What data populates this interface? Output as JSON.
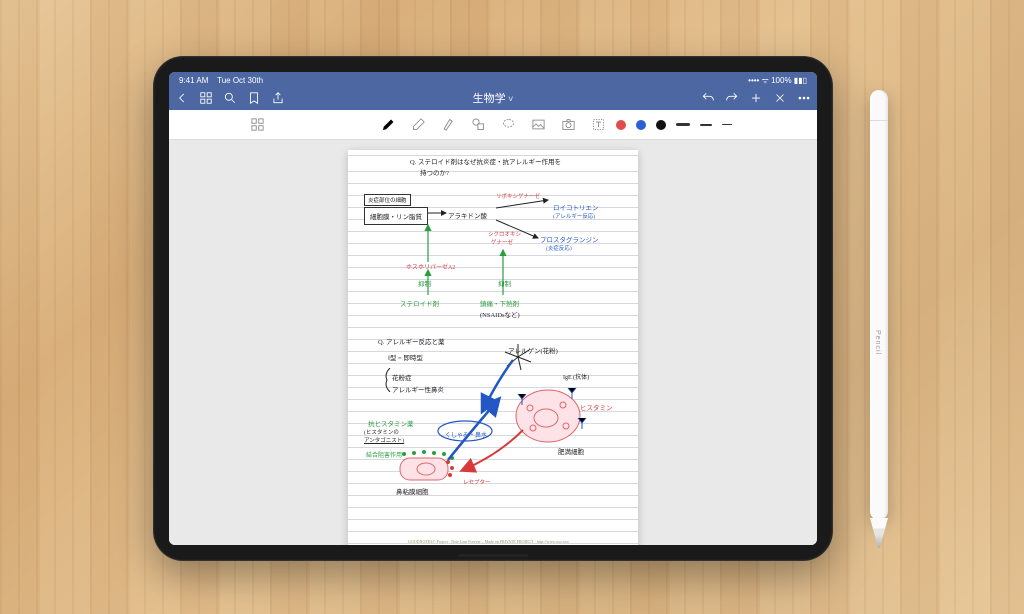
{
  "statusbar": {
    "time": "9:41 AM",
    "date": "Tue Oct 30th",
    "wifi": "100%"
  },
  "app": {
    "title": "生物学"
  },
  "nav": {
    "back": "‹",
    "grid": "grid",
    "search": "search",
    "bookmark": "bookmark",
    "share": "share",
    "undo": "undo",
    "redo": "redo",
    "add": "+",
    "close": "×",
    "more": "···"
  },
  "tools": {
    "palette": [
      "grid-view",
      "pen",
      "eraser",
      "highlighter",
      "shapes",
      "lasso",
      "image",
      "camera",
      "text"
    ],
    "colors": [
      "#e24b4b",
      "#2a5fd6",
      "#111111"
    ],
    "strokes": [
      14,
      10,
      7
    ]
  },
  "notes": {
    "q1_title": "Q. ステロイド剤はなぜ抗炎症・抗アレルギー作用を",
    "q1_title2": "持つのか?",
    "box_header": "炎症部位の細胞",
    "cell_membrane": "細胞膜・リン脂質",
    "arachidonic": "アラキドン酸",
    "lipoxygenase": "リポキシゲナーゼ",
    "leukotriene": "ロイコトリエン",
    "leukotriene_sub": "(アレルギー反応)",
    "cyclooxygenase": "シクロオキシ",
    "cyclooxygenase2": "ゲナーゼ",
    "prostaglandin": "プロスタグランジン",
    "prostaglandin_sub": "(炎症反応)",
    "phospholipase": "ホスホリパーゼA2",
    "inhibit_l": "抑制",
    "inhibit_r": "抑制",
    "steroid": "ステロイド剤",
    "analgesic": "鎮痛・下熱剤",
    "nsaids": "(NSAIDsなど)",
    "q2_title": "Q. アレルギー反応と薬",
    "type1": "Ⅰ型 = 即時型",
    "hay_fever": "花粉症",
    "rhinitis": "アレルギー性鼻炎",
    "allergen": "アレルゲン(花粉)",
    "ige": "IgE (抗体)",
    "histamine_r": "ヒスタミン",
    "mast_cell": "肥満細胞",
    "antihistamine": "抗ヒスタミン薬",
    "antihistamine2": "(ヒスタミンの",
    "antihistamine3": "アンタゴニスト)",
    "effect": "結合阻害作用",
    "sneeze": "くしゃみ・鼻水",
    "mucosa": "鼻粘膜細胞",
    "receptor": "レセプター",
    "footer": "GOODNOTES© Project · Note Line Forever – Made on PRIVATE PROJECT · http://www.xxx.xxx"
  },
  "pencil": {
    "label": " Pencil"
  }
}
